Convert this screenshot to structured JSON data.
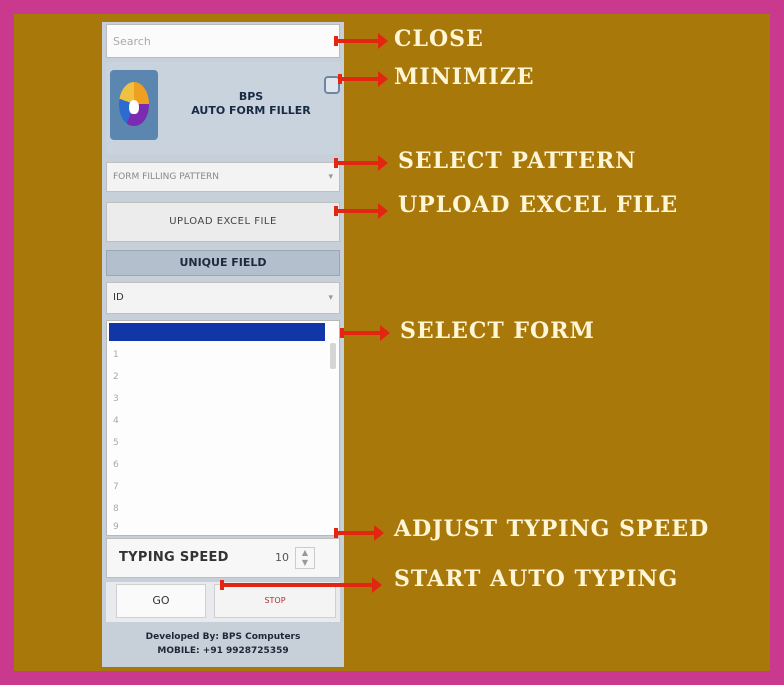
{
  "app": {
    "title_line1": "BPS",
    "title_line2": "AUTO FORM FILLER",
    "close_placeholder": "Search",
    "pattern_select": "FORM FILLING PATTERN",
    "upload_button": "UPLOAD EXCEL FILE",
    "unique_field_header": "UNIQUE FIELD",
    "unique_field_value": "ID",
    "form_list_items": [
      "1",
      "2",
      "3",
      "4",
      "5",
      "6",
      "7",
      "8",
      "9"
    ],
    "typing_speed_label": "TYPING SPEED",
    "typing_speed_value": "10",
    "go_button": "GO",
    "stop_button": "STOP",
    "footer_line1": "Developed By: BPS Computers",
    "footer_line2": "MOBILE: +91 9928725359"
  },
  "annotations": {
    "close": "CLOSE",
    "minimize": "MINIMIZE",
    "select_pattern": "SELECT PATTERN",
    "upload_excel": "UPLOAD EXCEL FILE",
    "select_form": "SELECT FORM",
    "adjust_speed": "ADJUST TYPING SPEED",
    "start_typing": "START AUTO TYPING"
  },
  "colors": {
    "frame": "#c93a8f",
    "background": "#a9780a",
    "arrow": "#e32612",
    "selection": "#1036a8"
  }
}
